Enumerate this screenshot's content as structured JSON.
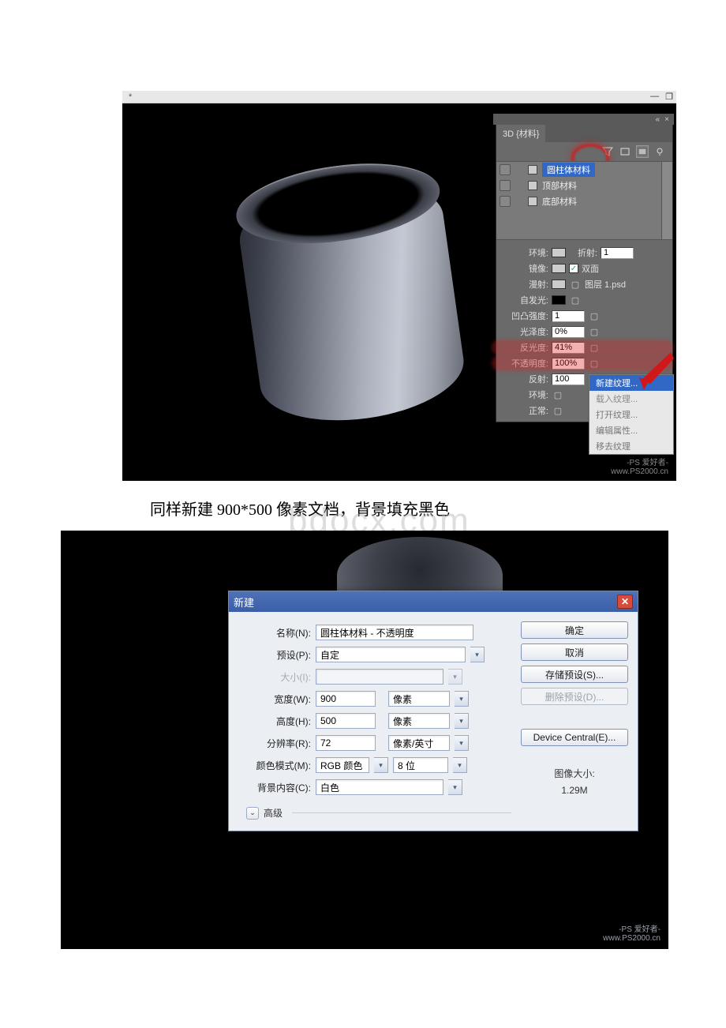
{
  "titlebar": {
    "modified": "*",
    "minimize": "—",
    "restore": "❐"
  },
  "panel3d": {
    "header_close": "×",
    "header_collapse": "«",
    "tab": "3D {材料}",
    "materials": [
      {
        "label": "圆柱体材料",
        "selected": true
      },
      {
        "label": "顶部材料",
        "selected": false
      },
      {
        "label": "底部材料",
        "selected": false
      }
    ],
    "props": {
      "env_label": "环境:",
      "refraction_label": "折射:",
      "refraction_value": "1",
      "mirror_label": "镜像:",
      "double_sided": "双面",
      "diffuse_label": "漫射:",
      "diffuse_file": "图层 1.psd",
      "selfillum_label": "自发光:",
      "bump_label": "凹凸强度:",
      "bump_value": "1",
      "gloss_label": "光泽度:",
      "gloss_value": "0%",
      "reflectance_label": "反光度:",
      "reflectance_value": "41%",
      "opacity_label": "不透明度:",
      "opacity_value": "100%",
      "reflection_label": "反射:",
      "reflection_value": "100",
      "env2_label": "环境:",
      "normal_label": "正常:"
    },
    "context_menu": [
      "新建纹理...",
      "载入纹理...",
      "打开纹理...",
      "编辑属性...",
      "移去纹理"
    ]
  },
  "watermark": {
    "line1": "-PS 爱好者-",
    "line2": "www.PS2000.cn"
  },
  "center_wm": "bdocx.com",
  "caption": "同样新建 900*500 像素文档，背景填充黑色",
  "dialog": {
    "title": "新建",
    "name_label": "名称(N):",
    "name_value": "圆柱体材料 - 不透明度",
    "preset_label": "预设(P):",
    "preset_value": "自定",
    "size_label": "大小(I):",
    "width_label": "宽度(W):",
    "width_value": "900",
    "width_unit": "像素",
    "height_label": "高度(H):",
    "height_value": "500",
    "height_unit": "像素",
    "res_label": "分辨率(R):",
    "res_value": "72",
    "res_unit": "像素/英寸",
    "mode_label": "颜色模式(M):",
    "mode_value": "RGB 颜色",
    "depth_value": "8 位",
    "bg_label": "背景内容(C):",
    "bg_value": "白色",
    "advanced": "高级",
    "ok": "确定",
    "cancel": "取消",
    "save_preset": "存储预设(S)...",
    "delete_preset": "删除预设(D)...",
    "device_central": "Device Central(E)...",
    "image_size_label": "图像大小:",
    "image_size_value": "1.29M"
  }
}
